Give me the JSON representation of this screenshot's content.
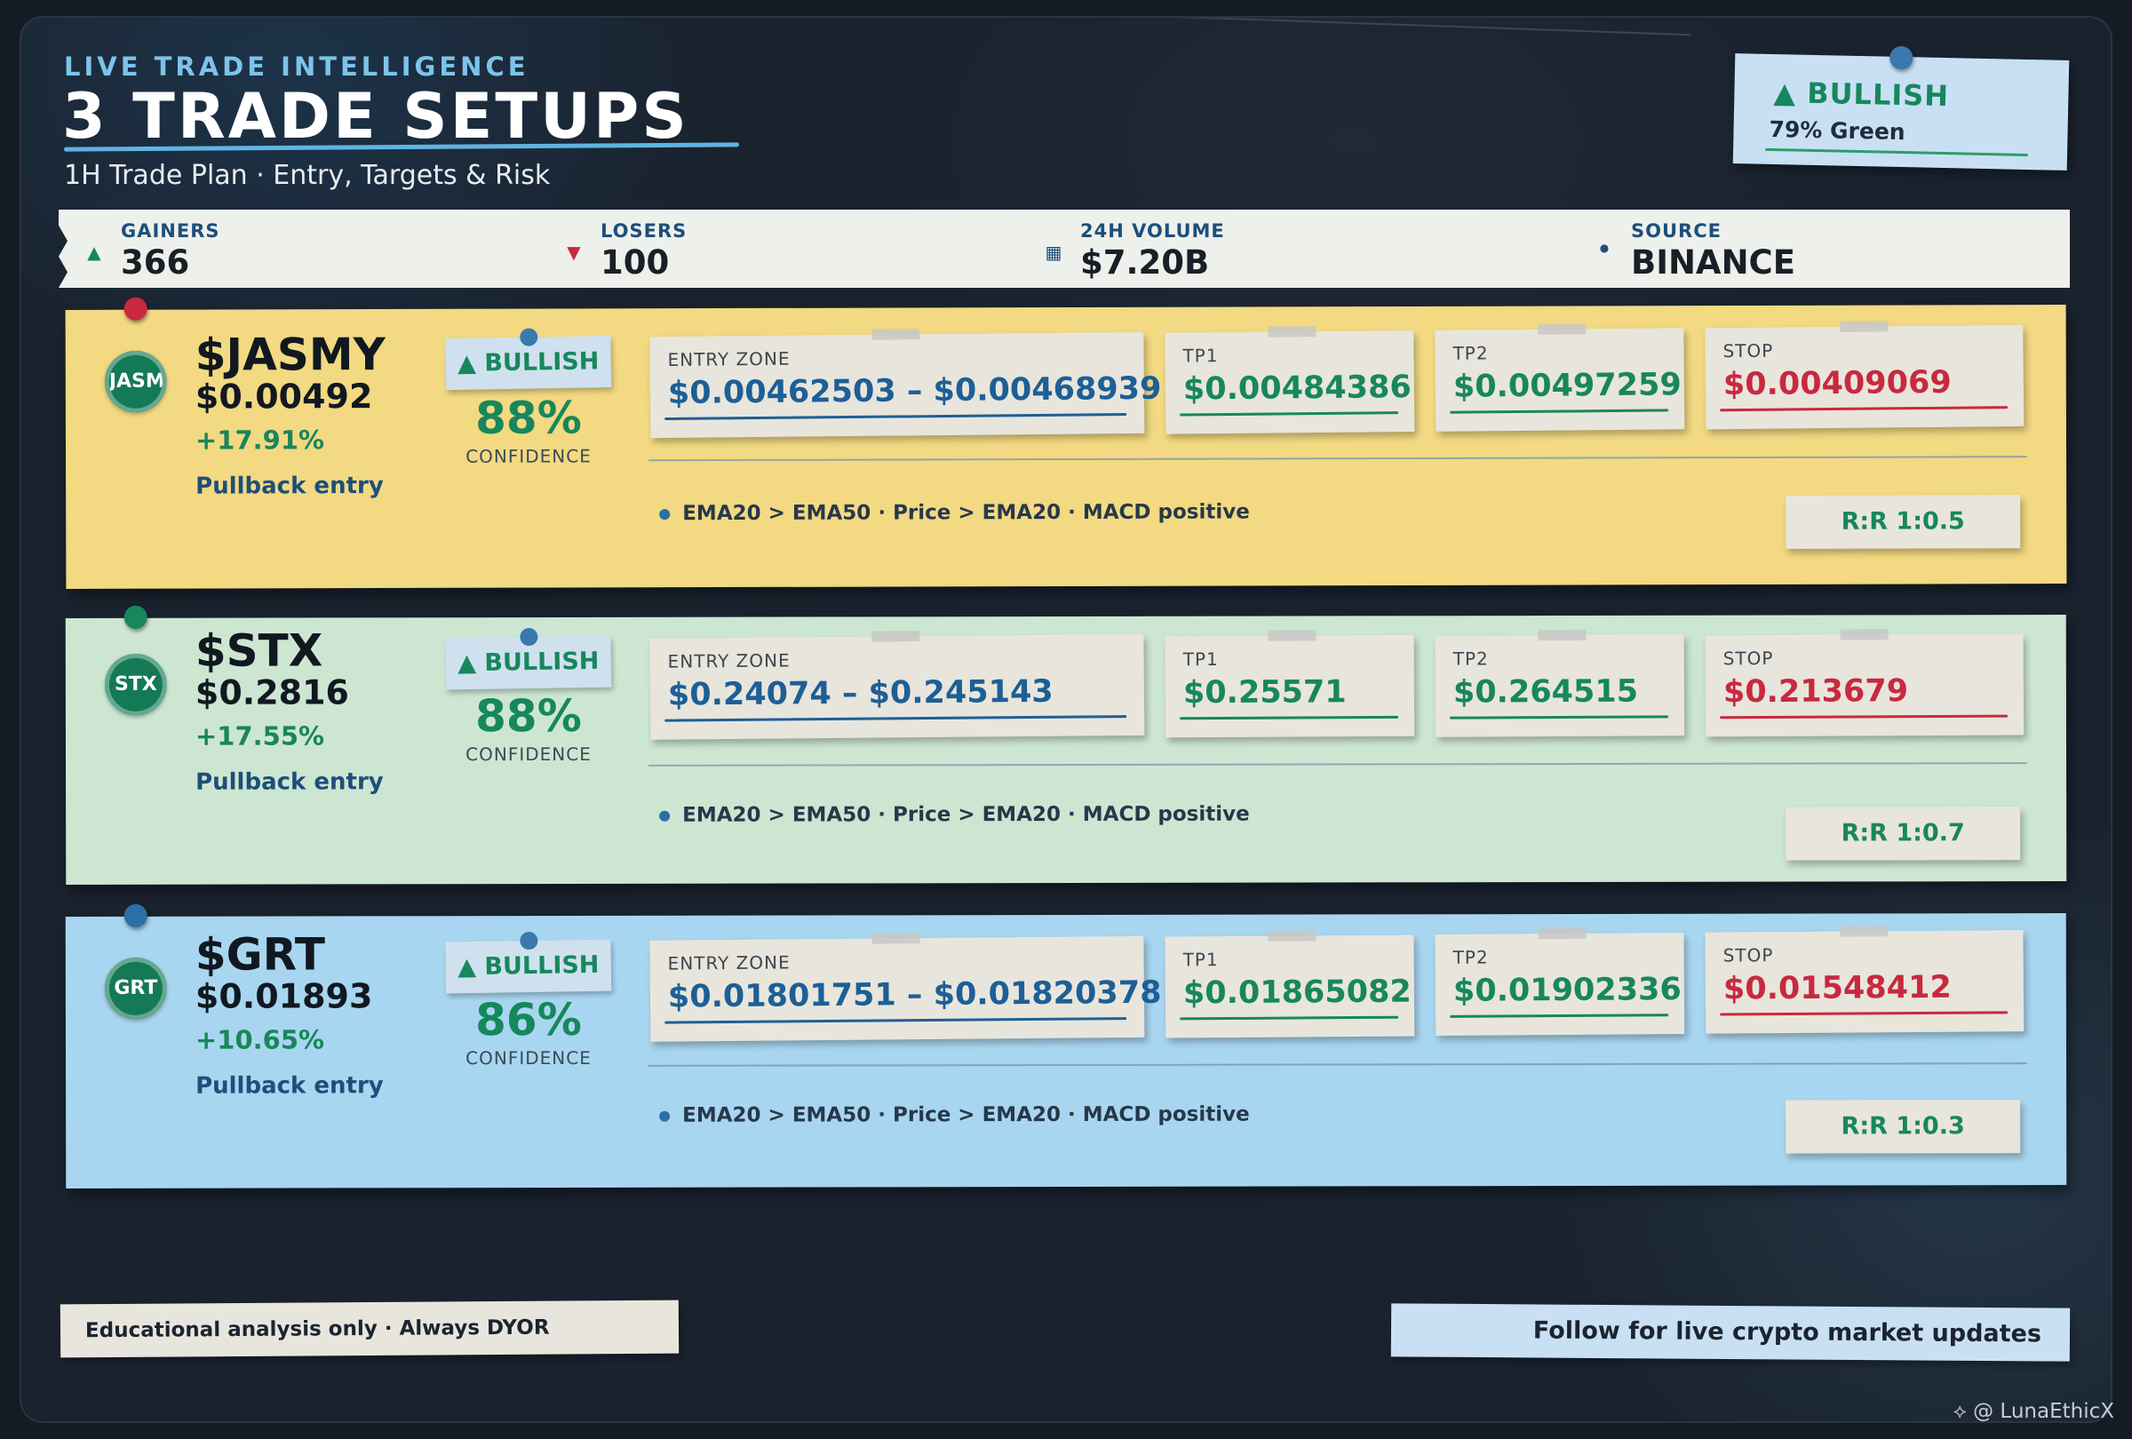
{
  "header": {
    "eyebrow": "LIVE TRADE INTELLIGENCE",
    "title": "3 TRADE SETUPS",
    "subtitle": "1H Trade Plan · Entry, Targets & Risk"
  },
  "sentiment": {
    "label": "▲ BULLISH",
    "detail": "79% Green"
  },
  "stats": [
    {
      "icon": "▲",
      "label": "GAINERS",
      "value": "366",
      "color": "#17875c"
    },
    {
      "icon": "▼",
      "label": "LOSERS",
      "value": "100",
      "color": "#c8293f"
    },
    {
      "icon": "▦",
      "label": "24H VOLUME",
      "value": "$7.20B",
      "color": "#1d4f7a"
    },
    {
      "icon": "●",
      "label": "SOURCE",
      "value": "BINANCE",
      "color": "#1d4f7a"
    }
  ],
  "cards": [
    {
      "badge": "JASM",
      "symbol": "$JASMY",
      "price": "$0.00492",
      "change": "+17.91%",
      "setup": "Pullback entry",
      "signal": "▲ BULLISH",
      "confidence": "88%",
      "confidence_label": "CONFIDENCE",
      "entry_label": "ENTRY ZONE",
      "entry": "$0.00462503 – $0.00468939",
      "tp1_label": "TP1",
      "tp1": "$0.00484386",
      "tp2_label": "TP2",
      "tp2": "$0.00497259",
      "stop_label": "STOP",
      "stop": "$0.00409069",
      "indicators": "EMA20 > EMA50 · Price > EMA20 · MACD positive",
      "rr": "R:R 1:0.5",
      "color": "#f2d982",
      "pin_color": "#c8293f"
    },
    {
      "badge": "STX",
      "symbol": "$STX",
      "price": "$0.2816",
      "change": "+17.55%",
      "setup": "Pullback entry",
      "signal": "▲ BULLISH",
      "confidence": "88%",
      "confidence_label": "CONFIDENCE",
      "entry_label": "ENTRY ZONE",
      "entry": "$0.24074 – $0.245143",
      "tp1_label": "TP1",
      "tp1": "$0.25571",
      "tp2_label": "TP2",
      "tp2": "$0.264515",
      "stop_label": "STOP",
      "stop": "$0.213679",
      "indicators": "EMA20 > EMA50 · Price > EMA20 · MACD positive",
      "rr": "R:R 1:0.7",
      "color": "#cde6d2",
      "pin_color": "#17875c"
    },
    {
      "badge": "GRT",
      "symbol": "$GRT",
      "price": "$0.01893",
      "change": "+10.65%",
      "setup": "Pullback entry",
      "signal": "▲ BULLISH",
      "confidence": "86%",
      "confidence_label": "CONFIDENCE",
      "entry_label": "ENTRY ZONE",
      "entry": "$0.01801751 – $0.01820378",
      "tp1_label": "TP1",
      "tp1": "$0.01865082",
      "tp2_label": "TP2",
      "tp2": "$0.01902336",
      "stop_label": "STOP",
      "stop": "$0.01548412",
      "indicators": "EMA20 > EMA50 · Price > EMA20 · MACD positive",
      "rr": "R:R 1:0.3",
      "color": "#a8d6f0",
      "pin_color": "#2a6fa6"
    }
  ],
  "footer": {
    "disclaimer": "Educational analysis only · Always DYOR",
    "cta": "Follow for live crypto market updates",
    "handle": "@ LunaEthicX"
  },
  "colors": {
    "green": "#17875c",
    "blue": "#1d5f96",
    "red": "#c8293f"
  }
}
